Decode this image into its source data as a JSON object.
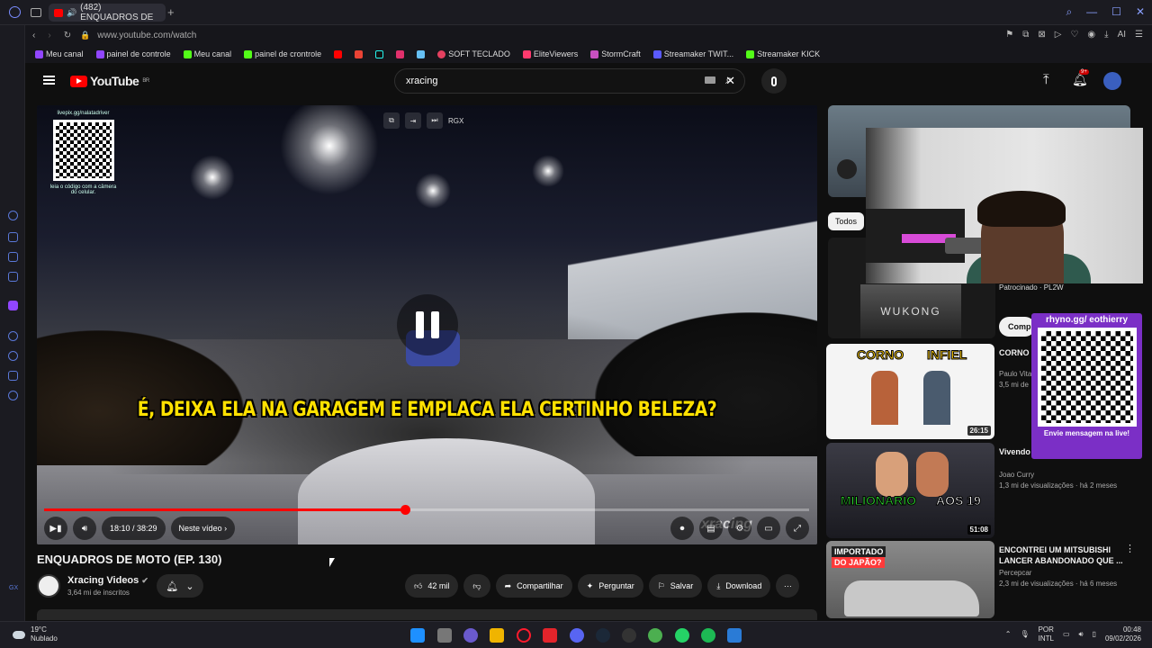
{
  "browser": {
    "tab_title": "(482) ENQUADROS DE",
    "url": "www.youtube.com/watch",
    "bookmarks": [
      "Meu canal",
      "painel de controle",
      "Meu canal",
      "painel de crontrole",
      "SOFT TECLADO",
      "EliteViewers",
      "StormCraft",
      "Streamaker TWIT...",
      "Streamaker KICK"
    ]
  },
  "header": {
    "logo": "YouTube",
    "region": "BR",
    "search_value": "xracing"
  },
  "player": {
    "qr_top": "livepix.gg/nalatadriver",
    "qr_caption": "leia o código com a câmera do celular.",
    "subtitle": "É, DEIXA ELA NA GARAGEM E EMPLACA ELA CERTINHO BELEZA?",
    "time": "18:10 / 38:29",
    "chapter": "Neste vídeo",
    "top_label": "RGX",
    "watermark": "xracing",
    "progress": 0.472
  },
  "video": {
    "title": "ENQUADROS DE MOTO (EP. 130)",
    "channel": "Xracing Videos",
    "subscribers": "3,64 mi de inscritos",
    "likes": "42 mil",
    "share": "Compartilhar",
    "ask": "Perguntar",
    "save": "Salvar",
    "download": "Download"
  },
  "sidebar": {
    "filter": "Todos",
    "sponsored": "Patrocinado · PL2W",
    "sponsor_btn": "Comp",
    "wukong": "WUKONG",
    "items": [
      {
        "title": "CORNO OU INFIEL reencont",
        "channel": "Paulo Vita",
        "meta": "3,5 mi de",
        "duration": "26:15",
        "thumb_a": "CORNO",
        "thumb_b": "INFIEL"
      },
      {
        "title": "Vivendo Streame...",
        "channel": "Joao Curry",
        "meta": "1,3 mi de visualizações · há 2 meses",
        "duration": "51:08",
        "thumb_a": "MILIONARIO",
        "thumb_b": "AOS 19"
      },
      {
        "title": "ENCONTREI UM MITSUBISHI LANCER ABANDONADO QUE ...",
        "channel": "Percepcar",
        "meta": "2,3 mi de visualizações · há 6 meses",
        "thumb_a": "IMPORTADO",
        "thumb_b": "DO JAPÃO?"
      }
    ]
  },
  "overlay": {
    "qr_label": "rhyno.gg/ eothierry",
    "qr_caption": "Envie mensagem na live!"
  },
  "taskbar": {
    "temp": "19°C",
    "weather": "Nublado",
    "lang": "POR",
    "layout": "INTL",
    "time": "00:48",
    "date": "09/02/2026"
  },
  "colors": {
    "accent": "#ff0000",
    "overlay": "#7b2fc6",
    "subtitle": "#ffe100"
  }
}
